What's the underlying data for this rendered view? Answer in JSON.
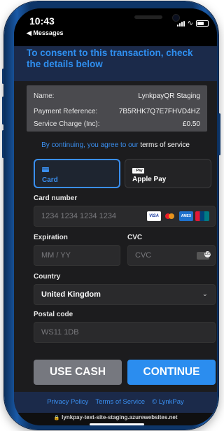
{
  "status": {
    "time": "10:43",
    "back_label": "◀ Messages"
  },
  "header": {
    "text": "To consent to this transaction, check the details below"
  },
  "summary": {
    "rows": [
      {
        "label": "Name:",
        "value": "LynkpayQR Staging"
      },
      {
        "label": "Payment Reference:",
        "value": "7B5RHK7Q7E7FHVD4HZ"
      },
      {
        "label": "Service Charge (Inc):",
        "value": "£0.50"
      }
    ]
  },
  "consent": {
    "prefix": "By continuing, you agree to our",
    "link": "terms of service"
  },
  "methods": [
    {
      "label": "Card",
      "icon": "card-icon",
      "selected": true
    },
    {
      "label": "Apple Pay",
      "icon": "apple-pay-icon",
      "selected": false
    }
  ],
  "form": {
    "card_number": {
      "label": "Card number",
      "placeholder": "1234 1234 1234 1234"
    },
    "expiration": {
      "label": "Expiration",
      "placeholder": "MM / YY"
    },
    "cvc": {
      "label": "CVC",
      "placeholder": "CVC"
    },
    "country": {
      "label": "Country",
      "value": "United Kingdom"
    },
    "postal": {
      "label": "Postal code",
      "placeholder": "WS11 1DB"
    }
  },
  "card_brands": [
    "VISA",
    "mastercard",
    "AMEX",
    "UnionPay"
  ],
  "buttons": {
    "use_cash": "USE CASH",
    "continue": "CONTINUE"
  },
  "footer": {
    "links": [
      "Privacy Policy",
      "Terms of Service",
      "© LynkPay"
    ]
  },
  "browser": {
    "url": "lynkpay-text-site-staging.azurewebsites.net"
  },
  "colors": {
    "accent": "#2b8def",
    "cash_button": "#76787f",
    "background": "#1c1c1e"
  }
}
